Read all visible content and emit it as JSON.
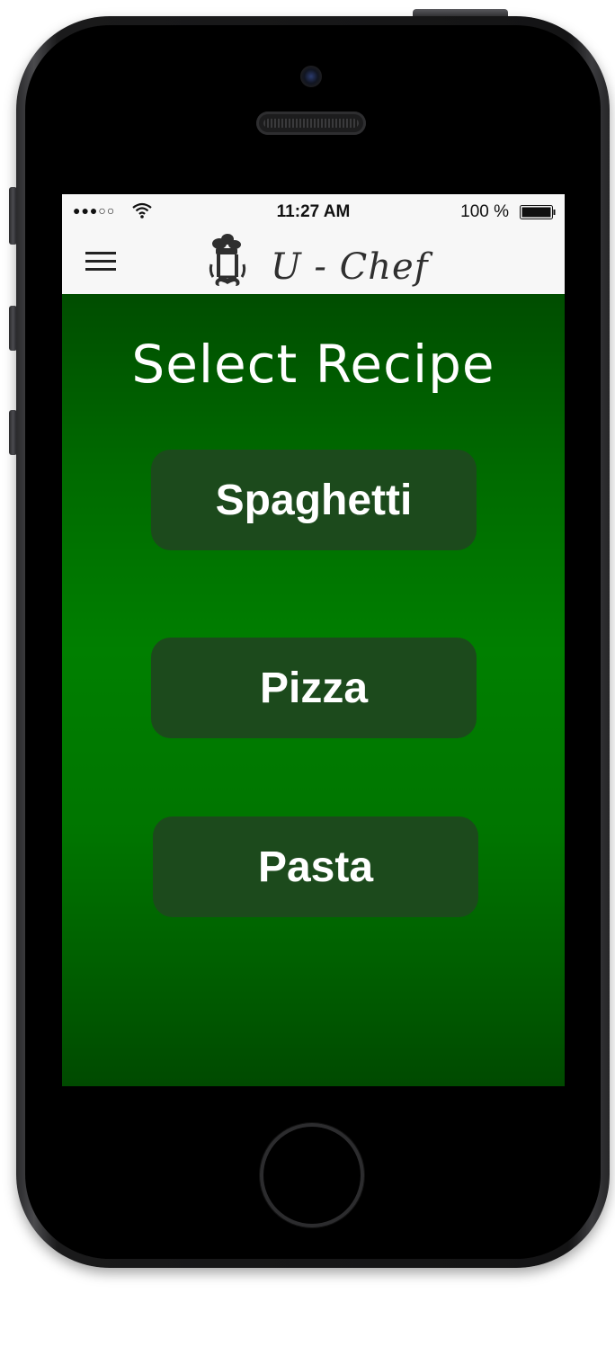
{
  "status_bar": {
    "signal": "●●●○○",
    "time": "11:27 AM",
    "battery": "100 %"
  },
  "nav": {
    "menu_icon": "hamburger-menu-icon",
    "logo_icon": "chef-hat-mustache-icon",
    "logo_text": "U - Chef"
  },
  "main": {
    "title": "Select Recipe",
    "recipes": [
      {
        "label": "Spaghetti"
      },
      {
        "label": "Pizza"
      },
      {
        "label": "Pasta"
      }
    ]
  },
  "colors": {
    "background_gradient_edge": "#004d00",
    "background_gradient_center": "#007f00",
    "button_bg": "#1c4a1c",
    "nav_bg": "#f7f7f7",
    "text": "#ffffff"
  }
}
